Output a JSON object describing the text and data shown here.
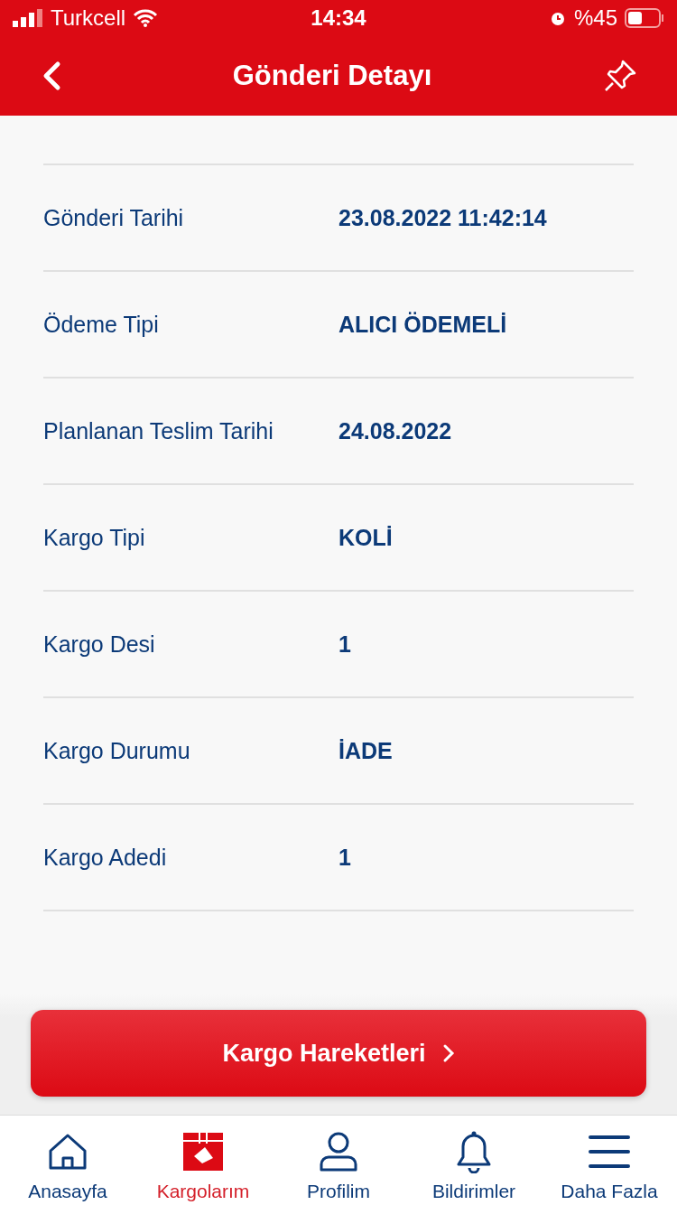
{
  "status_bar": {
    "carrier": "Turkcell",
    "time": "14:34",
    "battery": "%45"
  },
  "header": {
    "title": "Gönderi Detayı"
  },
  "details": [
    {
      "label": "Gönderi Tarihi",
      "value": "23.08.2022 11:42:14"
    },
    {
      "label": "Ödeme Tipi",
      "value": "ALICI ÖDEMELİ"
    },
    {
      "label": "Planlanan Teslim Tarihi",
      "value": "24.08.2022"
    },
    {
      "label": "Kargo Tipi",
      "value": "KOLİ"
    },
    {
      "label": "Kargo Desi",
      "value": "1"
    },
    {
      "label": "Kargo Durumu",
      "value": "İADE"
    },
    {
      "label": "Kargo Adedi",
      "value": "1"
    }
  ],
  "action_button": {
    "label": "Kargo Hareketleri"
  },
  "tab_bar": [
    {
      "kind": "home",
      "label": "Anasayfa",
      "selected": false
    },
    {
      "kind": "cargo",
      "label": "Kargolarım",
      "selected": true
    },
    {
      "kind": "profile",
      "label": "Profilim",
      "selected": false
    },
    {
      "kind": "bell",
      "label": "Bildirimler",
      "selected": false
    },
    {
      "kind": "menu",
      "label": "Daha Fazla",
      "selected": false
    }
  ]
}
